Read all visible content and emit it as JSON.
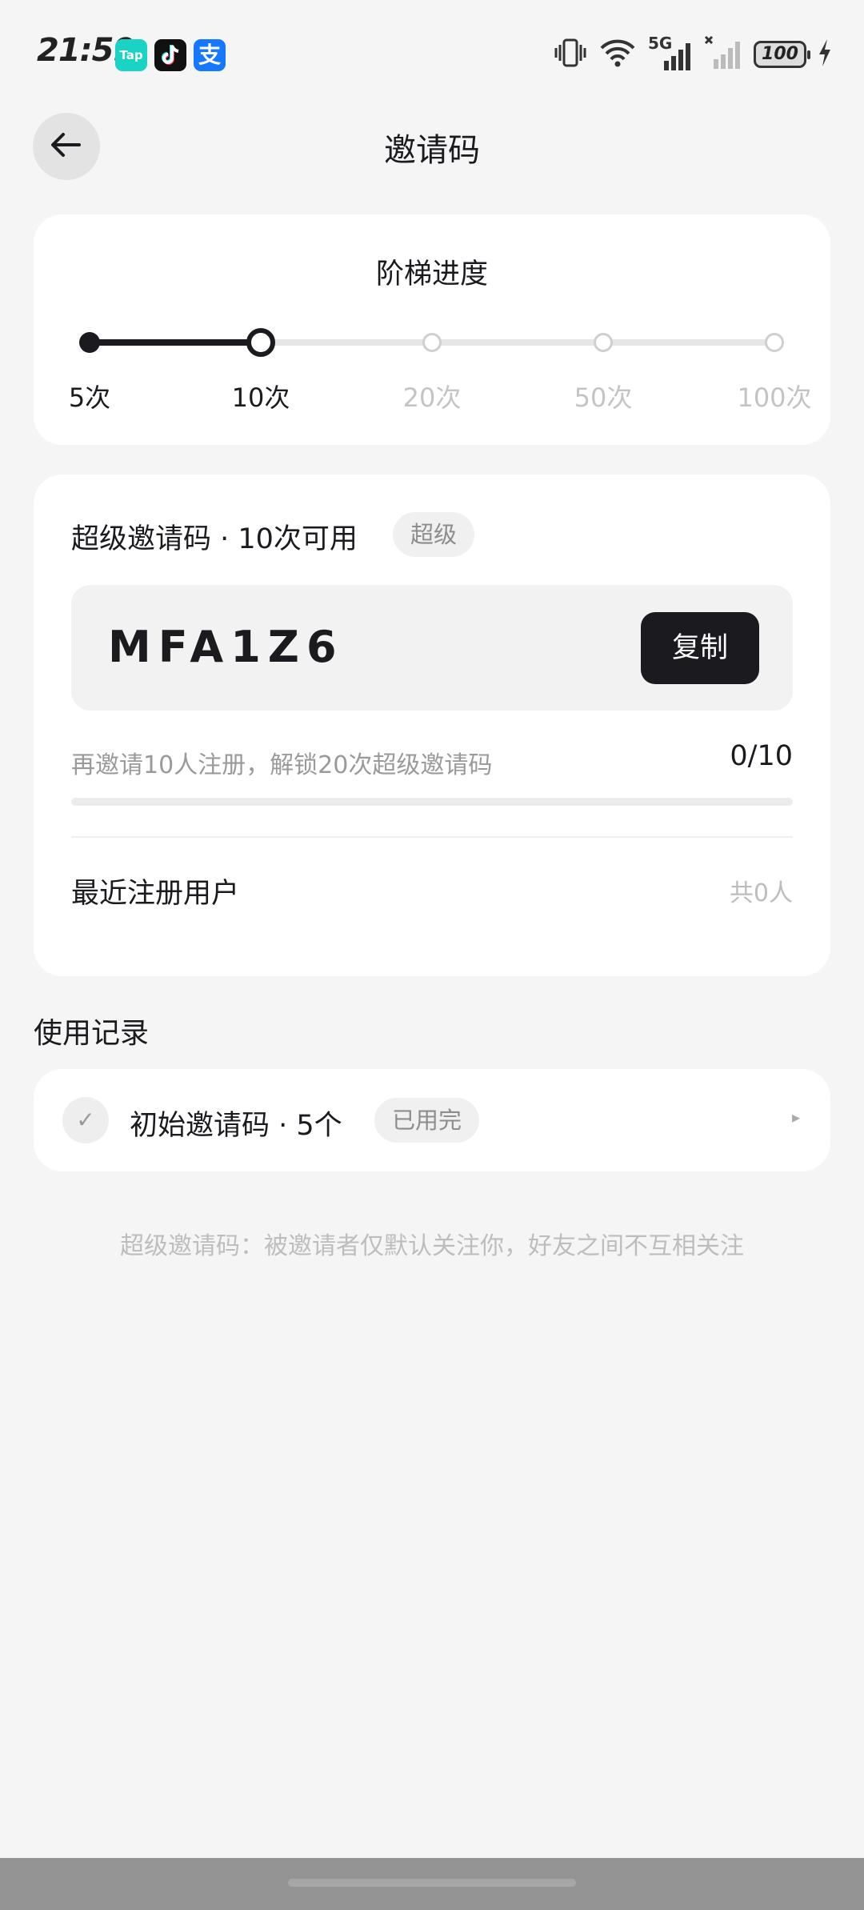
{
  "status_bar": {
    "time": "21:59",
    "apps": [
      {
        "name": "taptap-icon",
        "label": "Tap"
      },
      {
        "name": "tiktok-icon",
        "label": ""
      },
      {
        "name": "alipay-icon",
        "label": "支"
      }
    ],
    "network": "5G",
    "battery": "100"
  },
  "header": {
    "title": "邀请码"
  },
  "progress": {
    "title": "阶梯进度",
    "steps": [
      {
        "label": "5次",
        "state": "done"
      },
      {
        "label": "10次",
        "state": "current"
      },
      {
        "label": "20次",
        "state": "future"
      },
      {
        "label": "50次",
        "state": "future"
      },
      {
        "label": "100次",
        "state": "future"
      }
    ]
  },
  "invite": {
    "heading": "超级邀请码 · 10次可用",
    "badge": "超级",
    "code": "MFA1Z6",
    "copy_label": "复制",
    "hint": "再邀请10人注册，解锁20次超级邀请码",
    "count": "0/10",
    "progress_fraction": 0,
    "recent_title": "最近注册用户",
    "recent_count": "共0人"
  },
  "records": {
    "section_title": "使用记录",
    "items": [
      {
        "check": "✓",
        "label": "初始邀请码 · 5个",
        "badge": "已用完",
        "arrow": "▸"
      }
    ]
  },
  "footnote": "超级邀请码：被邀请者仅默认关注你，好友之间不互相关注",
  "colors": {
    "background": "#f5f5f5",
    "accent": "#1b1b1f",
    "muted": "#c4c4c4"
  }
}
